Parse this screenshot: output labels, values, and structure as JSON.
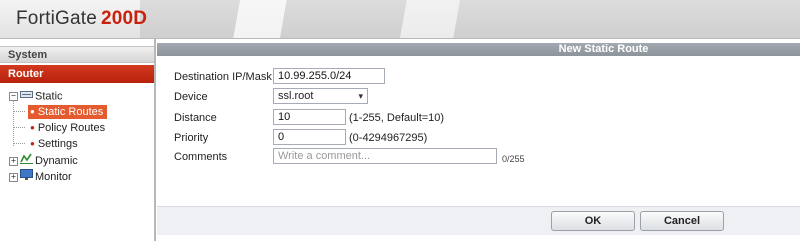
{
  "header": {
    "brand": "FortiGate",
    "model": "200D"
  },
  "sidebar": {
    "system_label": "System",
    "router_label": "Router",
    "tree": {
      "static": {
        "label": "Static",
        "expander": "−"
      },
      "static_children": [
        {
          "label": "Static Routes",
          "selected": true
        },
        {
          "label": "Policy Routes",
          "selected": false
        },
        {
          "label": "Settings",
          "selected": false
        }
      ],
      "dynamic": {
        "label": "Dynamic",
        "expander": "+"
      },
      "monitor": {
        "label": "Monitor",
        "expander": "+"
      }
    }
  },
  "panel": {
    "title": "New Static Route",
    "fields": {
      "destination": {
        "label": "Destination IP/Mask",
        "value": "10.99.255.0/24"
      },
      "device": {
        "label": "Device",
        "value": "ssl.root"
      },
      "distance": {
        "label": "Distance",
        "value": "10",
        "hint": "(1-255, Default=10)"
      },
      "priority": {
        "label": "Priority",
        "value": "0",
        "hint": "(0-4294967295)"
      },
      "comments": {
        "label": "Comments",
        "placeholder": "Write a comment...",
        "counter": "0/255"
      }
    },
    "buttons": {
      "ok": "OK",
      "cancel": "Cancel"
    }
  },
  "colors": {
    "brand_red": "#c8220f",
    "router_bar": "#c42c14",
    "selected_item": "#e35b2e",
    "panel_title": "#979ea5"
  }
}
